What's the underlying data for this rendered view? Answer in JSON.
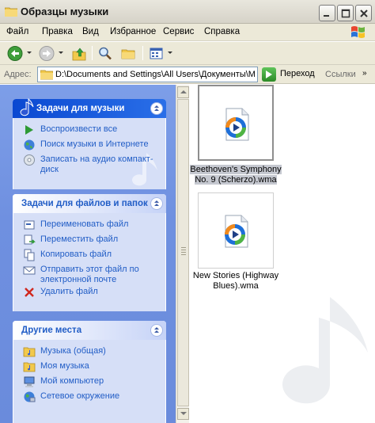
{
  "window": {
    "title": "Образцы музыки"
  },
  "menu": {
    "items": [
      "Файл",
      "Правка",
      "Вид",
      "Избранное",
      "Сервис",
      "Справка"
    ]
  },
  "address": {
    "label": "Адрес:",
    "path": "D:\\Documents and Settings\\All Users\\Документы\\М",
    "go_label": "Переход",
    "links_label": "Ссылки",
    "links_more": "»"
  },
  "task_panels": {
    "music": {
      "title": "Задачи для музыки",
      "tasks": [
        {
          "label": "Воспроизвести все",
          "icon": "play-icon"
        },
        {
          "label": "Поиск музыки в Интернете",
          "icon": "globe-icon"
        },
        {
          "label": "Записать на аудио компакт-диск",
          "icon": "cd-burn-icon"
        }
      ]
    },
    "file": {
      "title": "Задачи для файлов и папок",
      "tasks": [
        {
          "label": "Переименовать файл",
          "icon": "rename-icon"
        },
        {
          "label": "Переместить файл",
          "icon": "move-icon"
        },
        {
          "label": "Копировать файл",
          "icon": "copy-icon"
        },
        {
          "label": "Отправить этот файл по электронной почте",
          "icon": "email-icon"
        },
        {
          "label": "Удалить файл",
          "icon": "delete-icon"
        }
      ]
    },
    "other": {
      "title": "Другие места",
      "places": [
        {
          "label": "Музыка (общая)",
          "icon": "folder-music-icon"
        },
        {
          "label": "Моя музыка",
          "icon": "folder-music-icon"
        },
        {
          "label": "Мой компьютер",
          "icon": "computer-icon"
        },
        {
          "label": "Сетевое окружение",
          "icon": "network-icon"
        }
      ]
    }
  },
  "files": [
    {
      "name": "Beethoven's Symphony No. 9 (Scherzo).wma",
      "line1": "Beethoven's Symphony",
      "line2": "No. 9 (Scherzo).wma",
      "selected": true
    },
    {
      "name": "New Stories (Highway Blues).wma",
      "line1": "New Stories (Highway",
      "line2": "Blues).wma",
      "selected": false
    }
  ],
  "colors": {
    "task_link": "#215dc6",
    "pane_bg": "#6f90e0",
    "selection": "#c5c8d0"
  }
}
